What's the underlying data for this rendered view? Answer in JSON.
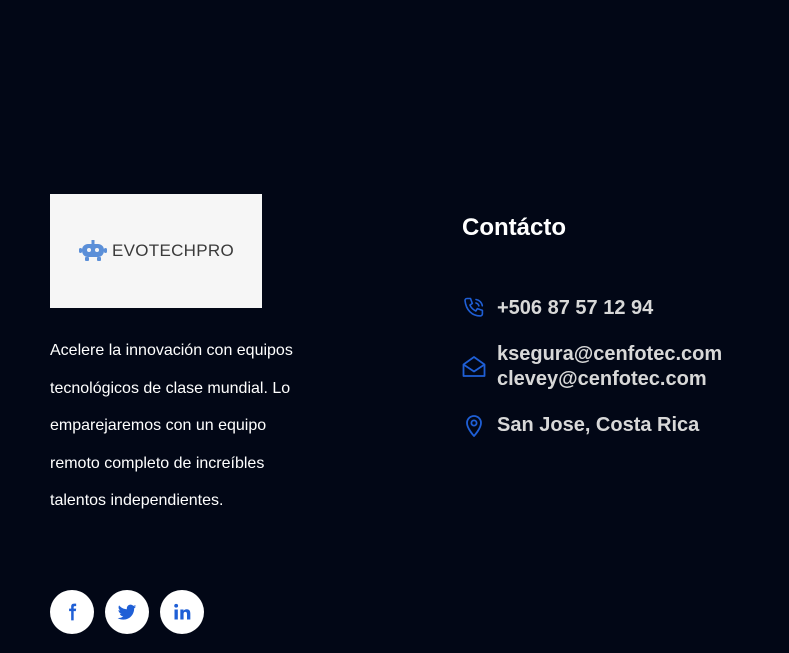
{
  "brand": {
    "logo_text": "EVOTECHPRO",
    "logo_icon": "robot-icon"
  },
  "about": {
    "description": "Acelere la innovación con equipos tecnológicos de clase mundial. Lo emparejaremos con un equipo remoto completo de increíbles talentos independientes."
  },
  "social": [
    {
      "name": "facebook",
      "icon": "facebook-icon"
    },
    {
      "name": "twitter",
      "icon": "twitter-icon"
    },
    {
      "name": "linkedin",
      "icon": "linkedin-icon",
      "label": "in"
    }
  ],
  "contact": {
    "title": "Contácto",
    "phone": "+506 87 57 12 94",
    "emails": [
      "ksegura@cenfotec.com",
      "clevey@cenfotec.com"
    ],
    "location": "San Jose, Costa Rica"
  },
  "colors": {
    "background": "#020716",
    "accent": "#1f5fd6",
    "logo_bg": "#f6f6f6",
    "contact_text": "#d8d8d8"
  }
}
